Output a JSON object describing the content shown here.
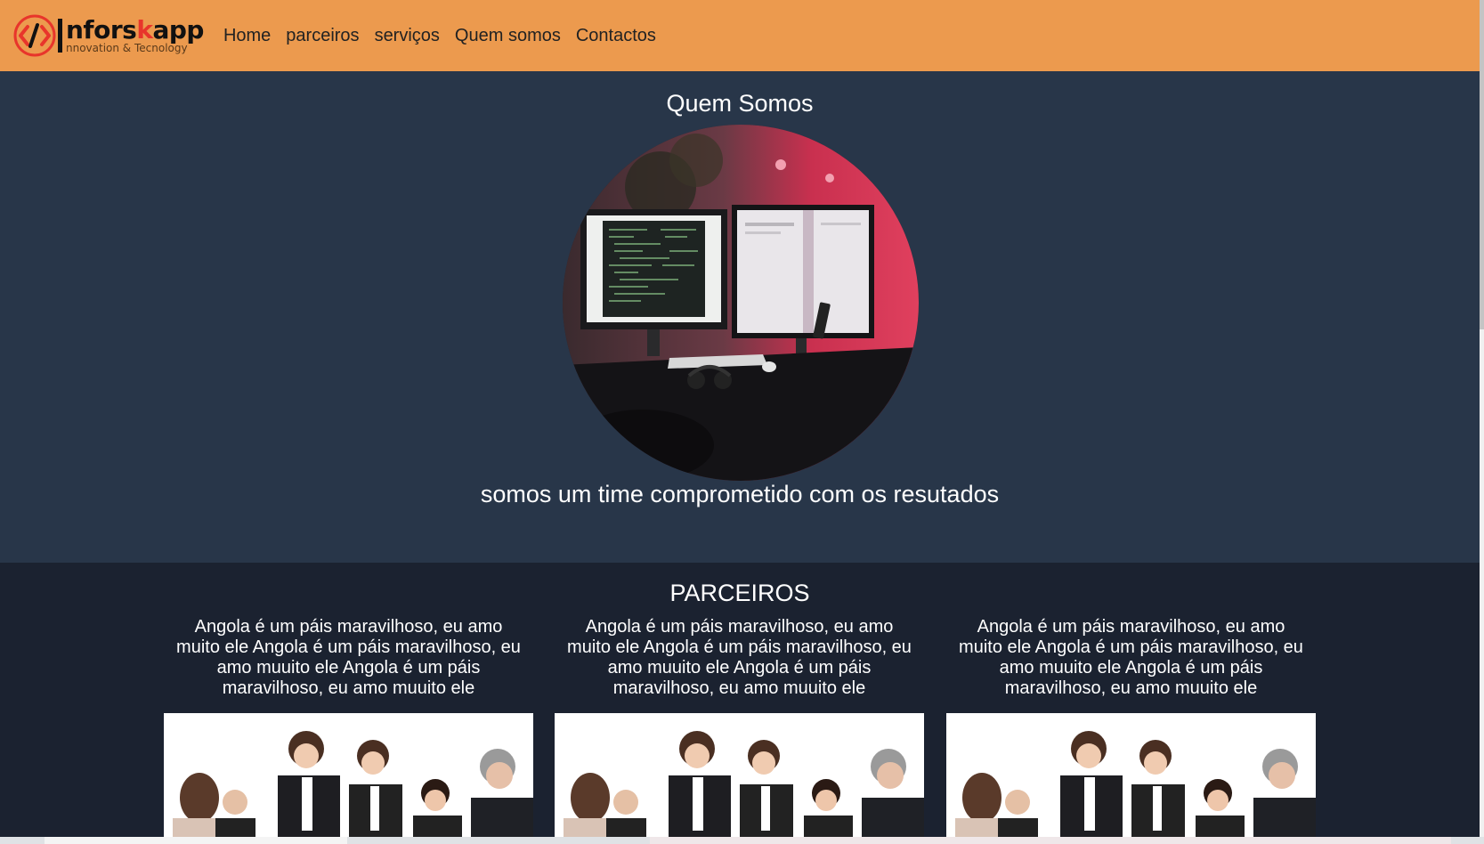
{
  "brand": {
    "name_main": "nforskapp",
    "tagline": "nnovation & Tecnology",
    "accent": "#ec9a4e"
  },
  "nav": {
    "items": [
      {
        "label": "Home"
      },
      {
        "label": "parceiros"
      },
      {
        "label": "serviços"
      },
      {
        "label": "Quem somos"
      },
      {
        "label": "Contactos"
      }
    ]
  },
  "about": {
    "title": "Quem Somos",
    "tagline": "somos um time comprometido com os resutados"
  },
  "partners": {
    "title": "PARCEIROS",
    "cards": [
      {
        "text": "Angola é um páis maravilhoso, eu amo muito ele Angola é um páis maravilhoso, eu amo muuito ele Angola é um páis maravilhoso, eu amo muuito ele"
      },
      {
        "text": "Angola é um páis maravilhoso, eu amo muito ele Angola é um páis maravilhoso, eu amo muuito ele Angola é um páis maravilhoso, eu amo muuito ele"
      },
      {
        "text": "Angola é um páis maravilhoso, eu amo muito ele Angola é um páis maravilhoso, eu amo muuito ele Angola é um páis maravilhoso, eu amo muuito ele"
      }
    ]
  }
}
